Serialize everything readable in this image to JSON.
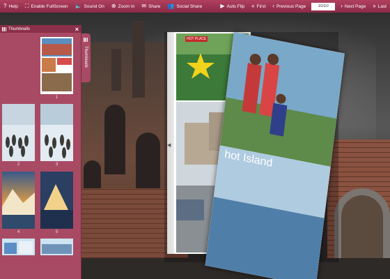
{
  "toolbar": {
    "help": "Help",
    "fullscreen": "Enable FullScreen",
    "sound": "Sound On",
    "zoom": "Zoom In",
    "share": "Share",
    "social_share": "Social Share",
    "auto_flip": "Auto Flip",
    "first": "First",
    "previous": "Previous Page",
    "page_value": "10/10",
    "next": "Next Page",
    "last": "Last"
  },
  "thumbnails": {
    "title": "Thumbnails",
    "tab_label": "Thumbnails",
    "pages": [
      "1",
      "2",
      "3",
      "4",
      "5"
    ]
  },
  "book": {
    "hot_place": "HOT PLACE",
    "island_text": "hot Island"
  },
  "colors": {
    "toolbar": "#9c3452",
    "panel": "#a84a64"
  }
}
